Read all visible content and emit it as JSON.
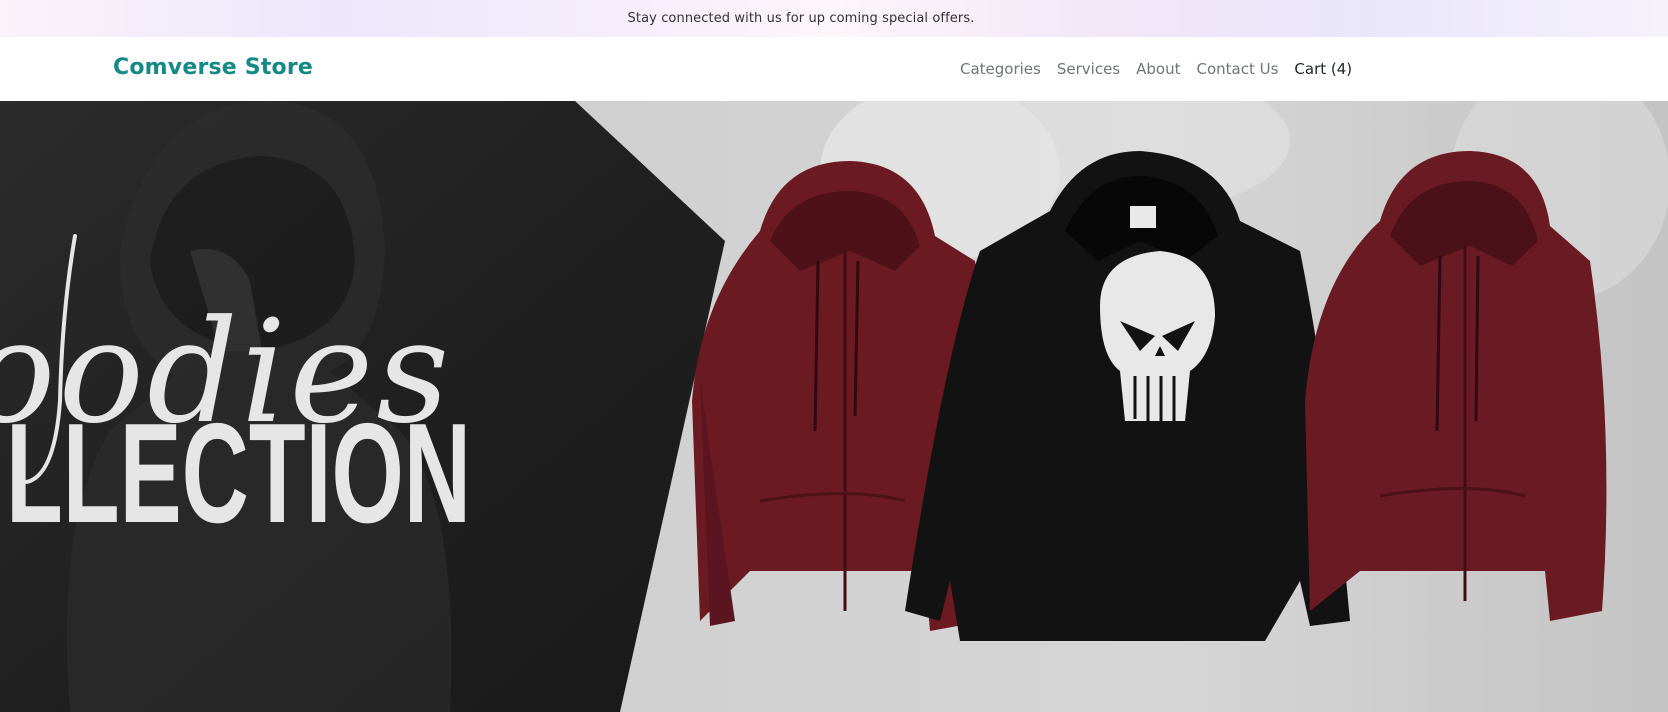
{
  "announcement": "Stay connected with us for up coming special offers.",
  "brand": {
    "name": "Comverse Store",
    "color": "#138a86"
  },
  "nav": {
    "items": [
      {
        "label": "Categories"
      },
      {
        "label": "Services"
      },
      {
        "label": "About"
      },
      {
        "label": "Contact Us"
      },
      {
        "label": "Cart (4)"
      }
    ]
  },
  "hero": {
    "script_word": "oodies",
    "bold_word": "LLECTION",
    "colors": {
      "maroon": "#6c1a22",
      "black": "#121212",
      "dark_panel": "#242424"
    }
  }
}
